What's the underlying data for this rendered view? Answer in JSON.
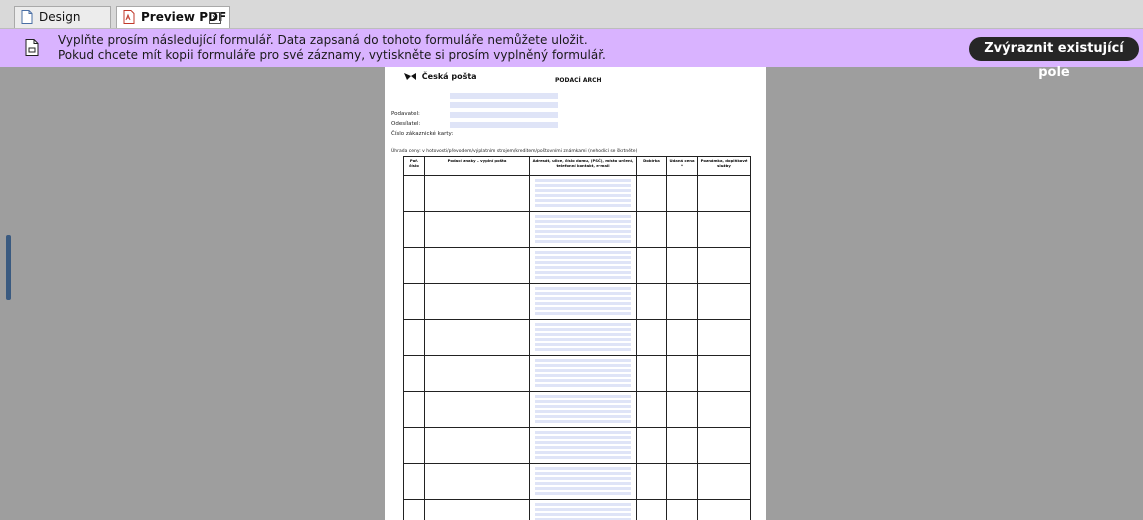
{
  "tabs": [
    {
      "label": "Design View",
      "icon": "document-icon"
    },
    {
      "label": "Preview PDF",
      "icon": "pdf-icon",
      "active": true
    }
  ],
  "infobar": {
    "line1": "Vyplňte prosím následující formulář. Data zapsaná do tohoto formuláře nemůžete uložit.",
    "line2": "Pokud chcete mít kopii formuláře pro své záznamy, vytiskněte si prosím vyplněný formulář.",
    "button": "Zvýraznit existující pole",
    "background": "#d9b3ff"
  },
  "pdf": {
    "logo_text": "Česká pošta",
    "title": "PODACÍ ARCH",
    "sender_label": "Podavatel:",
    "sender2_label": "Odesílatel:",
    "card_label": "Číslo zákaznické karty:",
    "payment_note": "Úhrada ceny: v hotovosti/převodem/výplatním strojem/kreditem/poštovními známkami (nehodící se škrtněte)",
    "columns": [
      "Poř. číslo",
      "Podací znaky – vyplní pošta",
      "Adresát, ulice, číslo domu, (PSČ), místo určení, telefonní kontakt, e-mail",
      "Dobírka",
      "Udaná cena *",
      "Poznámka, doplňkové služby"
    ],
    "row_count": 10,
    "field_color": "#dfe4f7"
  }
}
